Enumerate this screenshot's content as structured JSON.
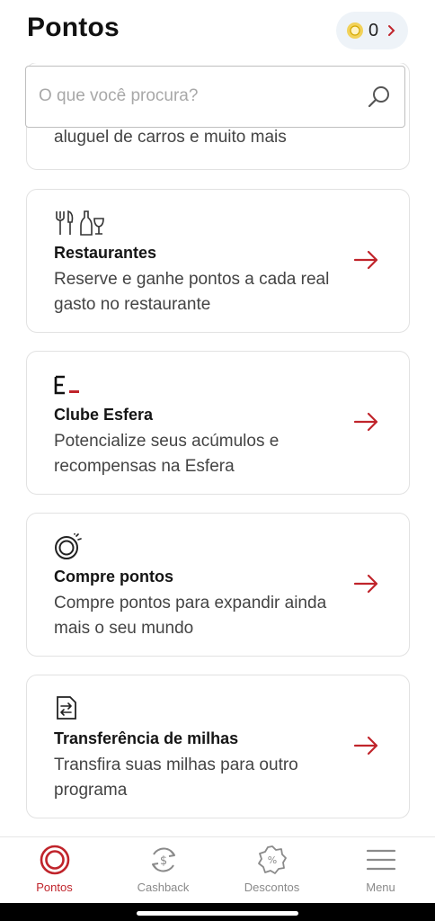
{
  "header": {
    "title": "Pontos",
    "points_balance": "0"
  },
  "search": {
    "placeholder": "O que você procura?",
    "value": ""
  },
  "partial_card": {
    "text": "aluguel de carros e muito mais"
  },
  "cards": [
    {
      "icon": "cutlery-wine-icon",
      "title": "Restaurantes",
      "description": "Reserve e ganhe pontos a cada real gasto no restaurante"
    },
    {
      "icon": "esfera-logo-icon",
      "title": "Clube Esfera",
      "description": "Potencialize seus acúmulos e recompensas na Esfera"
    },
    {
      "icon": "coin-sparkle-icon",
      "title": "Compre pontos",
      "description": "Compre pontos para expandir ainda mais o seu mundo"
    },
    {
      "icon": "transfer-icon",
      "title": "Transferência de milhas",
      "description": "Transfira suas milhas para outro programa"
    }
  ],
  "tabbar": {
    "tabs": [
      {
        "label": "Pontos",
        "icon": "target-icon",
        "active": true
      },
      {
        "label": "Cashback",
        "icon": "cashback-icon",
        "active": false
      },
      {
        "label": "Descontos",
        "icon": "discount-badge-icon",
        "active": false
      },
      {
        "label": "Menu",
        "icon": "hamburger-icon",
        "active": false
      }
    ]
  },
  "colors": {
    "accent": "#c0242b",
    "coin": "#e6b800",
    "text": "#1a1a1a",
    "muted": "#8a8a8a"
  }
}
